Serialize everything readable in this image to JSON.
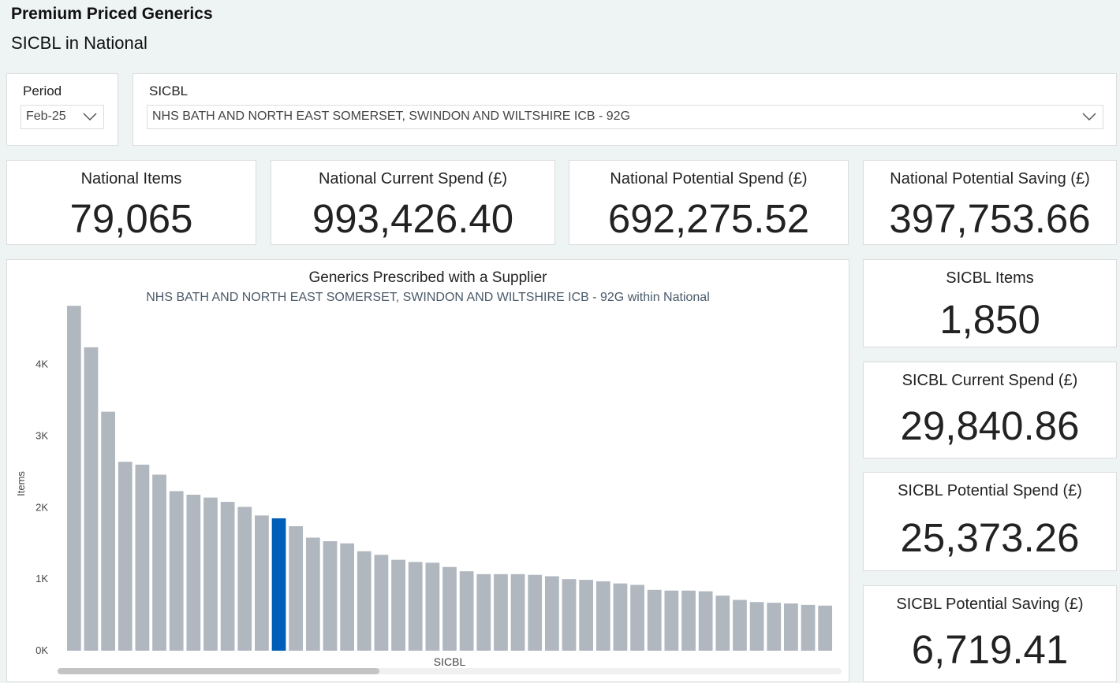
{
  "header": {
    "title": "Premium Priced Generics",
    "subtitle": "SICBL in National"
  },
  "filters": {
    "period": {
      "label": "Period",
      "value": "Feb-25"
    },
    "sicbl": {
      "label": "SICBL",
      "value": "NHS BATH AND NORTH EAST SOMERSET, SWINDON AND WILTSHIRE ICB - 92G"
    }
  },
  "national_kpis": {
    "items": {
      "label": "National Items",
      "value": "79,065"
    },
    "current_spend": {
      "label": "National Current Spend (£)",
      "value": "993,426.40"
    },
    "potential_spend": {
      "label": "National Potential Spend (£)",
      "value": "692,275.52"
    },
    "potential_saving": {
      "label": "National Potential Saving (£)",
      "value": "397,753.66"
    }
  },
  "sicbl_kpis": {
    "items": {
      "label": "SICBL Items",
      "value": "1,850"
    },
    "current_spend": {
      "label": "SICBL Current Spend (£)",
      "value": "29,840.86"
    },
    "potential_spend": {
      "label": "SICBL Potential Spend (£)",
      "value": "25,373.26"
    },
    "potential_saving": {
      "label": "SICBL Potential Saving (£)",
      "value": "6,719.41"
    }
  },
  "colors": {
    "bar": "#b0b7bf",
    "highlight": "#005eb8"
  },
  "scroll": {
    "visible_fraction": 0.41
  },
  "chart_data": {
    "type": "bar",
    "title": "Generics Prescribed with a Supplier",
    "subtitle": "NHS BATH AND NORTH EAST SOMERSET, SWINDON AND WILTSHIRE ICB - 92G within National",
    "xlabel": "SICBL",
    "ylabel": "Items",
    "ylim": [
      0,
      4800
    ],
    "yticks": [
      0,
      1000,
      2000,
      3000,
      4000
    ],
    "ytick_labels": [
      "0K",
      "1K",
      "2K",
      "3K",
      "4K"
    ],
    "highlight_index": 12,
    "values": [
      4820,
      4240,
      3340,
      2640,
      2600,
      2460,
      2230,
      2180,
      2140,
      2080,
      2010,
      1890,
      1850,
      1740,
      1580,
      1530,
      1500,
      1390,
      1340,
      1270,
      1240,
      1230,
      1170,
      1110,
      1070,
      1070,
      1070,
      1060,
      1040,
      1000,
      990,
      970,
      940,
      920,
      850,
      840,
      840,
      830,
      770,
      710,
      680,
      670,
      660,
      640,
      630
    ]
  }
}
